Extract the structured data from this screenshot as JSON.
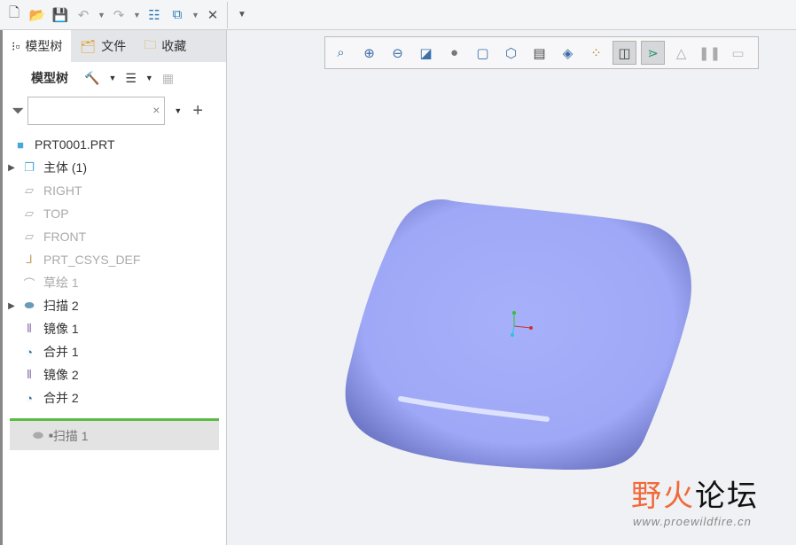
{
  "quick_access": {
    "icons": [
      "new-icon",
      "open-icon",
      "save-icon",
      "undo-icon",
      "redo-icon",
      "regenerate-icon",
      "windows-icon",
      "close-window-icon",
      "customize-icon"
    ]
  },
  "left_panel": {
    "tabs": [
      {
        "label": "模型树"
      },
      {
        "label": "文件"
      },
      {
        "label": "收藏"
      }
    ],
    "toolbar_title": "模型树",
    "filter_placeholder": "",
    "tree": [
      {
        "label": "PRT0001.PRT",
        "expandable": false,
        "dim": false,
        "icon": "part-icon"
      },
      {
        "label": "主体 (1)",
        "expandable": true,
        "dim": false,
        "icon": "body-icon"
      },
      {
        "label": "RIGHT",
        "expandable": false,
        "dim": true,
        "icon": "datum-plane-icon"
      },
      {
        "label": "TOP",
        "expandable": false,
        "dim": true,
        "icon": "datum-plane-icon"
      },
      {
        "label": "FRONT",
        "expandable": false,
        "dim": true,
        "icon": "datum-plane-icon"
      },
      {
        "label": "PRT_CSYS_DEF",
        "expandable": false,
        "dim": true,
        "icon": "csys-icon"
      },
      {
        "label": "草绘 1",
        "expandable": false,
        "dim": true,
        "icon": "sketch-icon"
      },
      {
        "label": "扫描 2",
        "expandable": true,
        "dim": false,
        "icon": "sweep-icon"
      },
      {
        "label": "镜像 1",
        "expandable": false,
        "dim": false,
        "icon": "mirror-icon"
      },
      {
        "label": "合并 1",
        "expandable": false,
        "dim": false,
        "icon": "merge-icon"
      },
      {
        "label": "镜像 2",
        "expandable": false,
        "dim": false,
        "icon": "mirror-icon"
      },
      {
        "label": "合并 2",
        "expandable": false,
        "dim": false,
        "icon": "merge-icon"
      }
    ],
    "suppressed_item": "扫描 1"
  },
  "view_toolbar": {
    "icons": [
      "refit-icon",
      "zoom-in-icon",
      "zoom-out-icon",
      "repaint-icon",
      "display-style-icon",
      "saved-views-icon",
      "view-manager-icon",
      "perspective-icon",
      "section-icon",
      "datum-display-icon",
      "annotation-display-icon",
      "spin-center-icon",
      "appearance-icon",
      "pause-icon",
      "animation-icon"
    ]
  },
  "watermark": {
    "name_a": "野火",
    "name_b": "论坛",
    "url": "www.proewildfire.cn"
  },
  "colors": {
    "model": "#a3acf5",
    "insert_bar": "#5cbb46",
    "logo_orange": "#f06a3a"
  }
}
